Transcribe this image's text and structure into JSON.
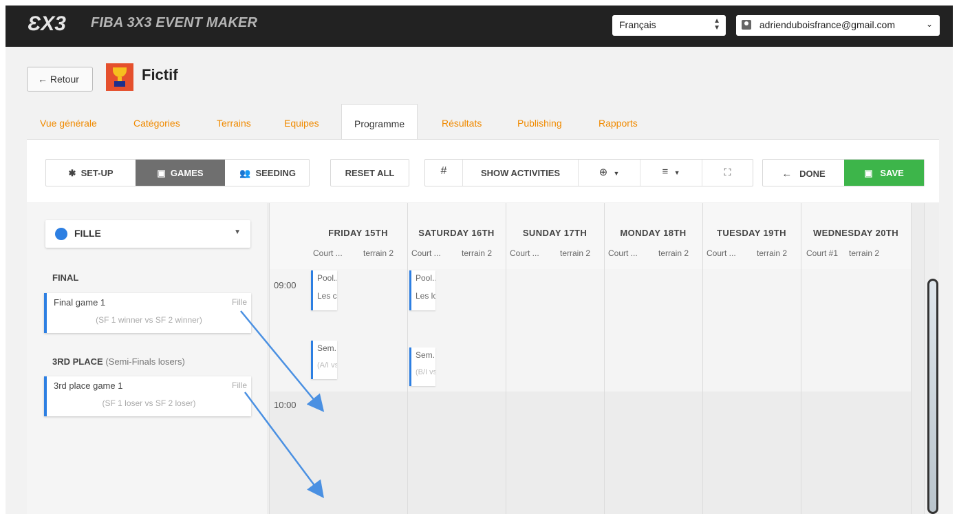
{
  "app": {
    "logo_text": "3x3",
    "title": "FIBA 3X3 EVENT MAKER",
    "language": "Français",
    "user_email": "adrienduboisfrance@gmail.com"
  },
  "header": {
    "back_label": "← Retour",
    "event_name": "Fictif"
  },
  "tabs": [
    {
      "label": "Vue générale"
    },
    {
      "label": "Catégories"
    },
    {
      "label": "Terrains"
    },
    {
      "label": "Equipes"
    },
    {
      "label": "Programme",
      "active": true
    },
    {
      "label": "Résultats"
    },
    {
      "label": "Publishing"
    },
    {
      "label": "Rapports"
    }
  ],
  "toolbar": {
    "setup": "SET-UP",
    "games": "GAMES",
    "seeding": "SEEDING",
    "reset_all": "RESET ALL",
    "hash": "#",
    "show_activities": "SHOW ACTIVITIES",
    "done": "DONE",
    "save": "SAVE"
  },
  "sidebar": {
    "category": "FILLE",
    "sections": [
      {
        "title": "FINAL",
        "subtitle": "",
        "game": {
          "name": "Final game 1",
          "category": "Fille",
          "match": "(SF 1 winner vs SF 2 winner)"
        }
      },
      {
        "title": "3RD PLACE",
        "subtitle": "(Semi-Finals losers)",
        "game": {
          "name": "3rd place game 1",
          "category": "Fille",
          "match": "(SF 1 loser vs SF 2 loser)"
        }
      }
    ]
  },
  "schedule": {
    "days": [
      {
        "name": "FRIDAY 15TH",
        "court1": "Court ...",
        "court2": "terrain 2"
      },
      {
        "name": "SATURDAY 16TH",
        "court1": "Court ...",
        "court2": "terrain 2"
      },
      {
        "name": "SUNDAY 17TH",
        "court1": "Court ...",
        "court2": "terrain 2"
      },
      {
        "name": "MONDAY 18TH",
        "court1": "Court ...",
        "court2": "terrain 2"
      },
      {
        "name": "TUESDAY 19TH",
        "court1": "Court ...",
        "court2": "terrain 2"
      },
      {
        "name": "WEDNESDAY 20TH",
        "court1": "Court #1",
        "court2": "terrain 2"
      }
    ],
    "times": [
      "09:00",
      "10:00"
    ],
    "cards": [
      {
        "l1": "Pool...",
        "l2": "Les cro"
      },
      {
        "l1": "Pool...",
        "l2": "Les lou"
      },
      {
        "l1": "Sem...",
        "l2": "(A/I vs"
      },
      {
        "l1": "Sem...",
        "l2": "(B/I vs"
      }
    ]
  },
  "colors": {
    "accent_orange": "#f08a00",
    "game_blue": "#2d7fe2",
    "save_green": "#3db54a",
    "topbar": "#222222"
  }
}
